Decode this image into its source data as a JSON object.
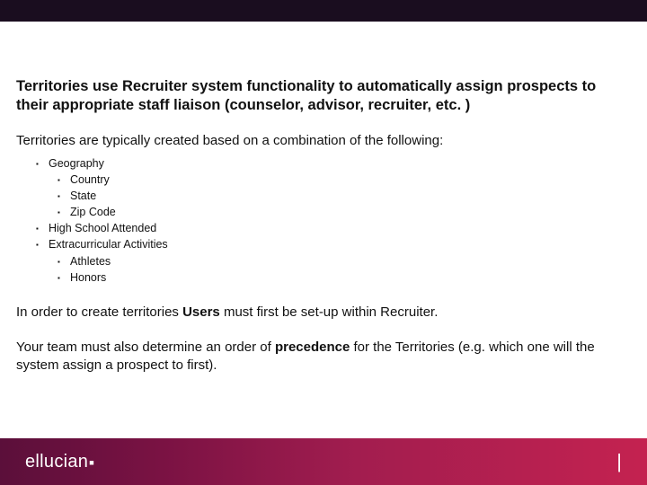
{
  "headline": "Territories use Recruiter system functionality to automatically assign prospects to their appropriate staff liaison (counselor, advisor, recruiter, etc. )",
  "intro": "Territories are typically created based on a combination of the following:",
  "bullets": {
    "b0": "Geography",
    "b0_0": "Country",
    "b0_1": "State",
    "b0_2": "Zip Code",
    "b1": "High School Attended",
    "b2": "Extracurricular Activities",
    "b2_0": "Athletes",
    "b2_1": "Honors"
  },
  "p2_a": "In order to create territories ",
  "p2_b": "Users",
  "p2_c": " must first be set-up within Recruiter.",
  "p3_a": "Your team must also determine an order of ",
  "p3_b": "precedence",
  "p3_c": " for the Territories (e.g. which one will the system assign a prospect to first).",
  "brand": "ellucian",
  "pipe": "|"
}
